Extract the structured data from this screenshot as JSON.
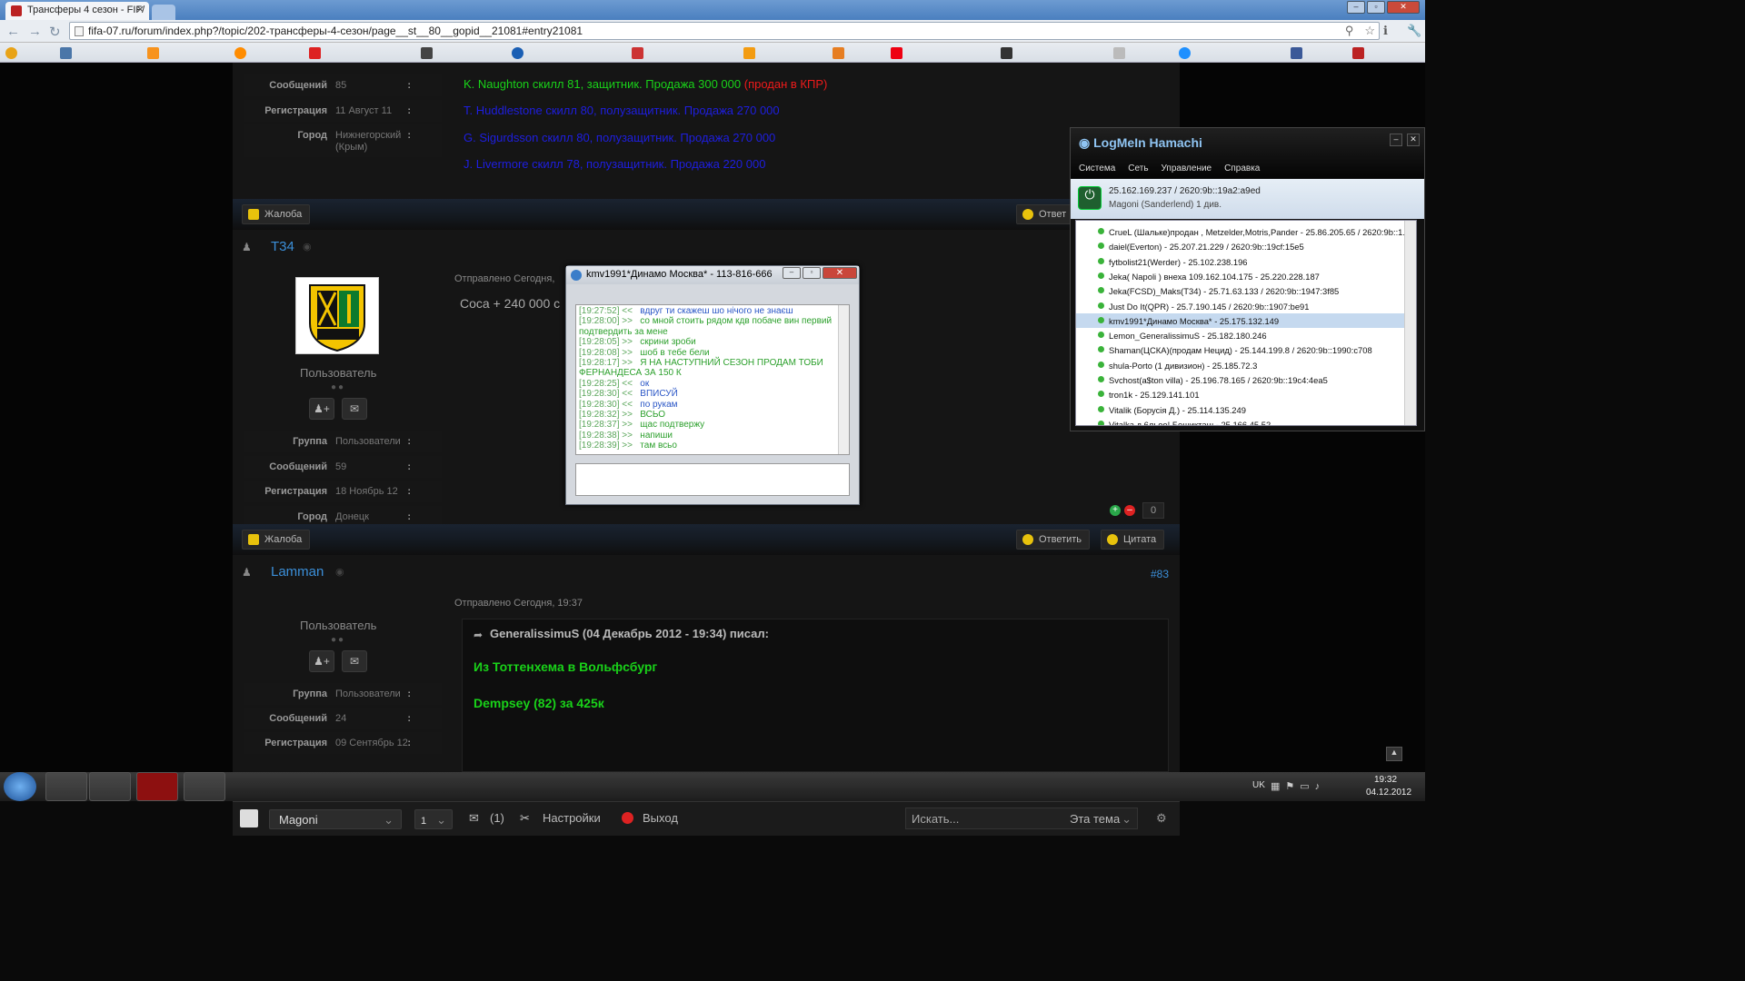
{
  "browser": {
    "tab_title": "Трансферы 4 сезон - FIF/",
    "url": "fifa-07.ru/forum/index.php?/topic/202-трансферы-4-сезон/page__st__80__gopid__21081#entry21081"
  },
  "posts": {
    "first": {
      "meta": [
        {
          "k": "Сообщений",
          "v": "85"
        },
        {
          "k": "Регистрация",
          "v": "11 Август 11"
        },
        {
          "k": "Город",
          "v": "Нижнегорский (Крым)"
        }
      ],
      "lines": [
        {
          "text": "K. Naughton скилл 81, защитник. Продажа 300 000",
          "extra": "(продан в КПР)"
        },
        {
          "text": "T. Huddlestone скилл 80, полузащитник. Продажа 270 000"
        },
        {
          "text": "G. Sigurdsson скилл 80, полузащитник. Продажа 270 000"
        },
        {
          "text": "J. Livermore скилл 78, полузащитник. Продажа 220 000"
        }
      ],
      "complaint": "Жалоба",
      "reply": "Ответ"
    },
    "second": {
      "username": "T34",
      "role": "Пользователь",
      "posted": "Отправлено Сегодня,",
      "text": "Coca + 240 000 c",
      "meta": [
        {
          "k": "Группа",
          "v": "Пользователи"
        },
        {
          "k": "Сообщений",
          "v": "59"
        },
        {
          "k": "Регистрация",
          "v": "18 Ноябрь 12"
        },
        {
          "k": "Город",
          "v": "Донецк"
        }
      ],
      "rep": "0",
      "complaint": "Жалоба",
      "reply": "Ответить",
      "quote": "Цитата"
    },
    "third": {
      "username": "Lamman",
      "num": "#83",
      "role": "Пользователь",
      "posted": "Отправлено Сегодня, 19:37",
      "meta": [
        {
          "k": "Группа",
          "v": "Пользователи"
        },
        {
          "k": "Сообщений",
          "v": "24"
        },
        {
          "k": "Регистрация",
          "v": "09 Сентябрь 12"
        }
      ],
      "quote_header": "GeneralissimuS (04 Декабрь 2012 - 19:34) писал:",
      "quote_line1": "Из Тоттенхема в Вольфсбург",
      "quote_line2": "Dempsey (82) за 425к"
    }
  },
  "bottombar": {
    "user": "Magoni",
    "count": "1",
    "messages": "(1)",
    "settings": "Настройки",
    "logout": "Выход",
    "search_placeholder": "Искать...",
    "scope": "Эта тема"
  },
  "chat": {
    "title": "kmv1991*Динамо Москва* - 113-816-666",
    "log": [
      {
        "ts": "[19:27:52] <<",
        "msg": "вдруг ти скажеш шо нічого не знаєш",
        "dir": "in"
      },
      {
        "ts": "[19:28:00] >>",
        "msg": "со мной стоить рядом кдв побаче вин первий подтвердить за мене",
        "dir": "out"
      },
      {
        "ts": "[19:28:05] >>",
        "msg": "скрини зроби",
        "dir": "out"
      },
      {
        "ts": "[19:28:08] >>",
        "msg": "шоб в тебе бели",
        "dir": "out"
      },
      {
        "ts": "[19:28:17] >>",
        "msg": "Я НА НАСТУПНИЙ СЕЗОН ПРОДАМ ТОБИ ФЕРНАНДЕСА ЗА 150 К",
        "dir": "out"
      },
      {
        "ts": "[19:28:25] <<",
        "msg": "ок",
        "dir": "in"
      },
      {
        "ts": "[19:28:30] <<",
        "msg": "ВПИСУЙ",
        "dir": "in"
      },
      {
        "ts": "[19:28:30] <<",
        "msg": "по рукам",
        "dir": "in"
      },
      {
        "ts": "[19:28:32] >>",
        "msg": "ВСЬО",
        "dir": "out"
      },
      {
        "ts": "[19:28:37] >>",
        "msg": "щас подтвержу",
        "dir": "out"
      },
      {
        "ts": "[19:28:38] >>",
        "msg": "напиши",
        "dir": "out"
      },
      {
        "ts": "[19:28:39] >>",
        "msg": "там всьо",
        "dir": "out"
      }
    ]
  },
  "hamachi": {
    "title": "LogMeIn Hamachi",
    "menu": [
      "Система",
      "Сеть",
      "Управление",
      "Справка"
    ],
    "ip": "25.162.169.237 / 2620:9b::19a2:a9ed",
    "name": "Magoni (Sanderlend) 1 див.",
    "peers": [
      "CrueL (Шальке)продан , Metzelder,Motris,Pander - 25.86.205.65 / 2620:9b::1...",
      "daiel(Everton) - 25.207.21.229 / 2620:9b::19cf:15e5",
      "fytbolist21(Werder) - 25.102.238.196",
      "Jeka( Napoli ) внеха 109.162.104.175 - 25.220.228.187",
      "Jeka(FCSD)_Maks(T34) - 25.71.63.133 / 2620:9b::1947:3f85",
      "Just Do It(QPR) - 25.7.190.145 / 2620:9b::1907:be91",
      "kmv1991*Динамо Москва* - 25.175.132.149",
      "Lemon_GeneralissimuS - 25.182.180.246",
      "Shaman(ЦСКА)(продам Нецид) - 25.144.199.8 / 2620:9b::1990:c708",
      "shula-Porto (1 дивизион) - 25.185.72.3",
      "Svchost(a$ton villa) - 25.196.78.165 / 2620:9b::19c4:4ea5",
      "tron1k - 25.129.141.101",
      "Vitalik (Борусія Д.)  - 25.114.135.249",
      "Vitalka д 6льоо! Бешикташ - 25.166.45.52"
    ]
  },
  "taskbar": {
    "lang": "UK",
    "time": "19:32",
    "date": "04.12.2012"
  }
}
